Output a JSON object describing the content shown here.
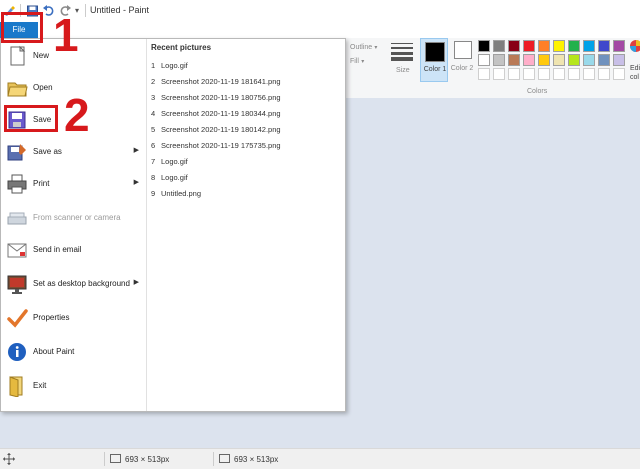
{
  "window": {
    "title": "Untitled - Paint"
  },
  "quick_access": {
    "dropdown_glyph": "▾"
  },
  "tabs": {
    "file": "File"
  },
  "ribbon": {
    "outline_label": "Outline",
    "fill_label": "Fill",
    "size_label": "Size",
    "color1_label": "Color 1",
    "color2_label": "Color 2",
    "colors_group_label": "Colors",
    "edit_colors_label": "Edi col",
    "palette_row1": [
      "#000000",
      "#7f7f7f",
      "#880015",
      "#ed1c24",
      "#ff7f27",
      "#fff200",
      "#22b14c",
      "#00a2e8",
      "#3f48cc",
      "#a349a4"
    ],
    "palette_row2": [
      "#ffffff",
      "#c3c3c3",
      "#b97a57",
      "#ffaec9",
      "#ffc90e",
      "#efe4b0",
      "#b5e61d",
      "#99d9ea",
      "#7092be",
      "#c8bfe7"
    ],
    "color1": "#000000",
    "color2": "#ffffff"
  },
  "file_menu": {
    "items": [
      {
        "label": "New",
        "icon": "new-document-icon",
        "has_arrow": false,
        "disabled": false
      },
      {
        "label": "Open",
        "icon": "open-folder-icon",
        "has_arrow": false,
        "disabled": false
      },
      {
        "label": "Save",
        "icon": "save-disk-icon",
        "has_arrow": false,
        "disabled": false
      },
      {
        "label": "Save as",
        "icon": "save-as-icon",
        "has_arrow": true,
        "disabled": false
      },
      {
        "label": "Print",
        "icon": "printer-icon",
        "has_arrow": true,
        "disabled": false
      },
      {
        "label": "From scanner or camera",
        "icon": "scanner-icon",
        "has_arrow": false,
        "disabled": true
      },
      {
        "label": "Send in email",
        "icon": "email-icon",
        "has_arrow": false,
        "disabled": false
      },
      {
        "label": "Set as desktop background",
        "icon": "desktop-background-icon",
        "has_arrow": true,
        "disabled": false
      },
      {
        "label": "Properties",
        "icon": "checkmark-icon",
        "has_arrow": false,
        "disabled": false
      },
      {
        "label": "About Paint",
        "icon": "info-icon",
        "has_arrow": false,
        "disabled": false
      },
      {
        "label": "Exit",
        "icon": "exit-icon",
        "has_arrow": false,
        "disabled": false
      }
    ],
    "arrow_glyph": "▶",
    "recent_title": "Recent pictures",
    "recent": [
      {
        "num": "1",
        "name": "Logo.gif"
      },
      {
        "num": "2",
        "name": "Screenshot 2020-11-19 181641.png"
      },
      {
        "num": "3",
        "name": "Screenshot 2020-11-19 180756.png"
      },
      {
        "num": "4",
        "name": "Screenshot 2020-11-19 180344.png"
      },
      {
        "num": "5",
        "name": "Screenshot 2020-11-19 180142.png"
      },
      {
        "num": "6",
        "name": "Screenshot 2020-11-19 175735.png"
      },
      {
        "num": "7",
        "name": "Logo.gif"
      },
      {
        "num": "8",
        "name": "Logo.gif"
      },
      {
        "num": "9",
        "name": "Untitled.png"
      }
    ]
  },
  "annotations": {
    "step1": "1",
    "step2": "2",
    "color": "#d7191c"
  },
  "status": {
    "selection_size": "693 × 513px",
    "image_size": "693 × 513px"
  }
}
